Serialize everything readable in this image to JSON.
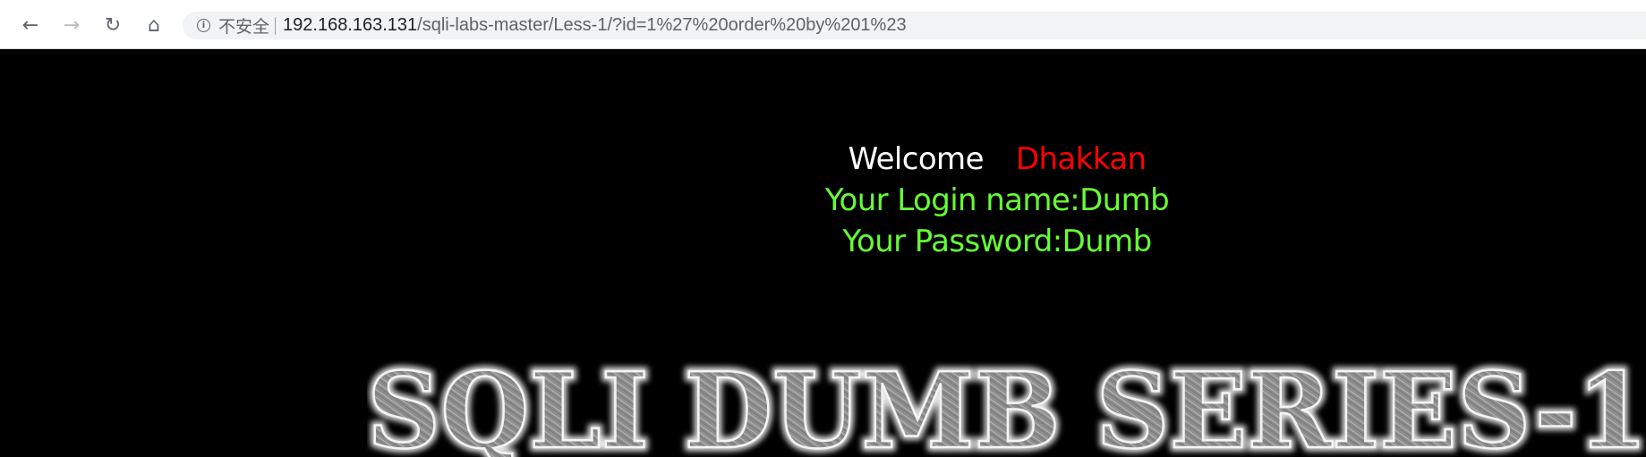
{
  "browser": {
    "security_label": "不安全",
    "url_host": "192.168.163.131",
    "url_path": "/sqli-labs-master/Less-1/?id=1%27%20order%20by%201%23",
    "icons": {
      "back": "back-arrow-icon",
      "forward": "forward-arrow-icon",
      "reload": "reload-icon",
      "home": "home-icon",
      "security": "info-icon"
    }
  },
  "content": {
    "welcome_label": "Welcome",
    "welcome_name": "Dhakkan",
    "login_name_line": "Your Login name:Dumb",
    "password_line": "Your Password:Dumb",
    "banner_text": "SQLI DUMB SERIES-1"
  },
  "colors": {
    "background": "#000000",
    "welcome": "#ffffff",
    "name": "#ff0000",
    "result": "#66ff33",
    "banner": "#9a9a9a"
  }
}
